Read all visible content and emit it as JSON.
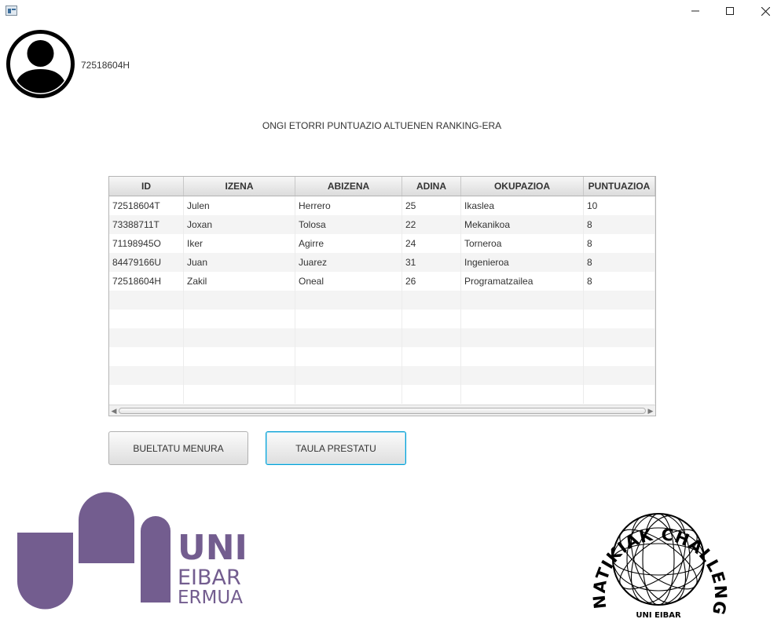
{
  "window": {
    "icons": {
      "app": "app-window-icon",
      "minimize": "minimize-icon",
      "maximize": "maximize-icon",
      "close": "close-icon"
    }
  },
  "user": {
    "id": "72518604H",
    "avatar_icon": "user-avatar-icon"
  },
  "welcome_text": "ONGI ETORRI PUNTUAZIO ALTUENEN RANKING-ERA",
  "table": {
    "headers": [
      "ID",
      "IZENA",
      "ABIZENA",
      "ADINA",
      "OKUPAZIOA",
      "PUNTUAZIOA"
    ],
    "rows": [
      [
        "72518604T",
        "Julen",
        "Herrero",
        "25",
        "Ikaslea",
        "10"
      ],
      [
        "73388711T",
        "Joxan",
        "Tolosa",
        "22",
        "Mekanikoa",
        "8"
      ],
      [
        "71198945O",
        "Iker",
        "Agirre",
        "24",
        "Torneroa",
        "8"
      ],
      [
        "84479166U",
        "Juan",
        "Juarez",
        "31",
        "Ingenieroa",
        "8"
      ],
      [
        "72518604H",
        "Zakil",
        "Oneal",
        "26",
        "Programatzailea",
        "8"
      ]
    ],
    "empty_rows": 6
  },
  "buttons": {
    "back": "BUELTATU MENURA",
    "prepare": "TAULA PRESTATU"
  },
  "logos": {
    "uni": {
      "line1": "UNI",
      "line2": "EIBAR",
      "line3": "ERMUA",
      "color": "#735d8f"
    },
    "challenge": {
      "arc_text": "NATIKIAK CHALLENGE",
      "bottom_text": "UNI EIBAR"
    }
  },
  "colors": {
    "focus_border": "#039ed3",
    "uni_purple": "#735d8f"
  }
}
